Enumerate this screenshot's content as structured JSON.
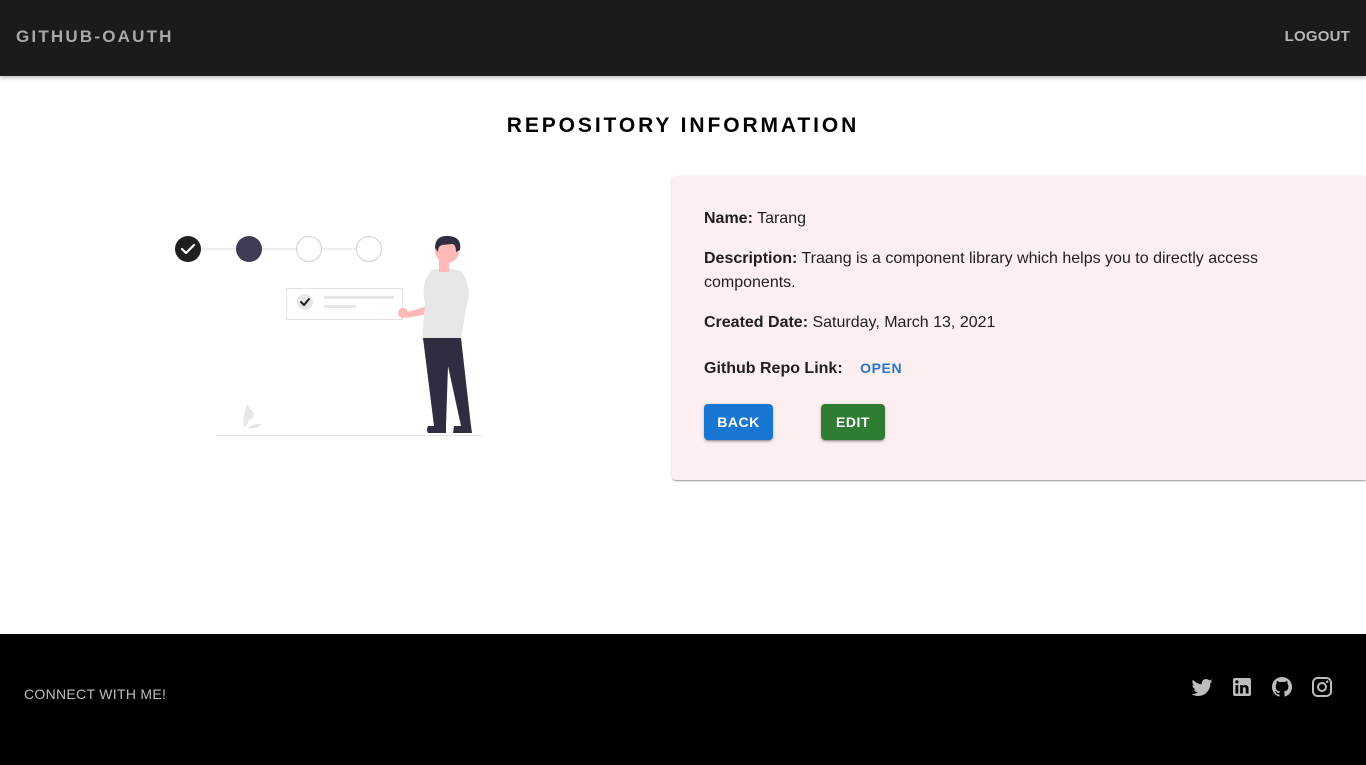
{
  "header": {
    "brand": "GITHUB-OAUTH",
    "logout_label": "LOGOUT"
  },
  "main": {
    "title": "REPOSITORY INFORMATION",
    "repo": {
      "name_label": "Name:",
      "name_value": "Tarang",
      "description_label": "Description:",
      "description_value": "Traang is a component library which helps you to directly access components.",
      "created_label": "Created Date:",
      "created_value": "Saturday, March 13, 2021",
      "link_label": "Github Repo Link:",
      "link_text": "OPEN"
    },
    "buttons": {
      "back_label": "BACK",
      "edit_label": "EDIT"
    },
    "colors": {
      "card_background": "#fdefef",
      "back_button": "#1976d2",
      "edit_button": "#2e7d32",
      "link": "#2475c9"
    }
  },
  "illustration": {
    "icon": "progress-steps-person-illustration",
    "steps_completed": 2,
    "steps_total": 4
  },
  "footer": {
    "connect_text": "CONNECT WITH ME!",
    "social_icons": [
      "twitter-icon",
      "linkedin-icon",
      "github-icon",
      "instagram-icon"
    ]
  }
}
